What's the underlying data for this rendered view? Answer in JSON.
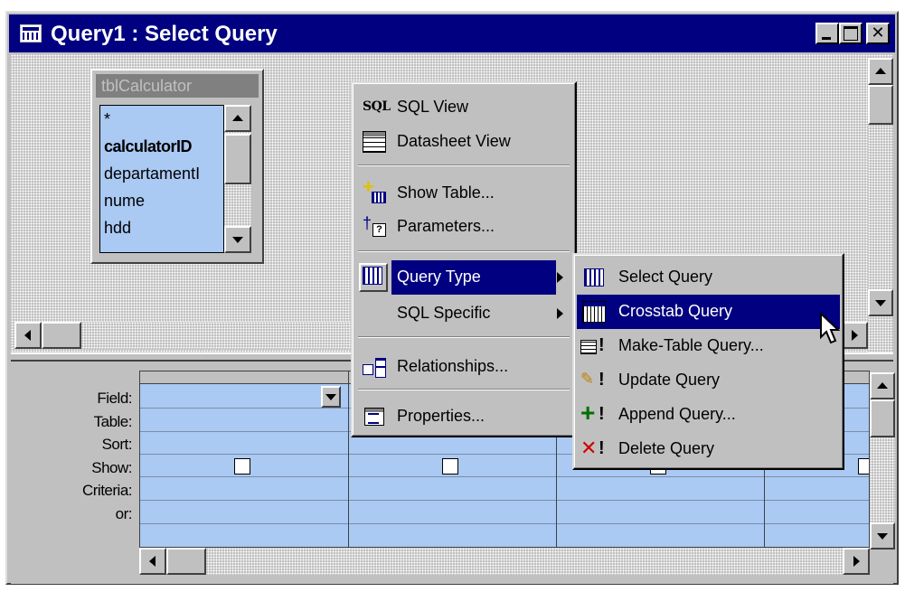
{
  "window": {
    "title": "Query1 : Select Query",
    "close_glyph": "✕"
  },
  "field_list": {
    "title": "tblCalculator",
    "items": [
      "*",
      "calculatorID",
      "departamentI",
      "nume",
      "hdd"
    ]
  },
  "grid": {
    "row_labels": [
      "Field:",
      "Table:",
      "Sort:",
      "Show:",
      "Criteria:",
      "or:"
    ]
  },
  "context_menu": {
    "sql_glyph": "SQL",
    "sql_view": "SQL View",
    "datasheet_view": "Datasheet View",
    "show_table": "Show Table...",
    "parameters": "Parameters...",
    "query_type": "Query Type",
    "sql_specific": "SQL Specific",
    "relationships": "Relationships...",
    "properties": "Properties..."
  },
  "submenu": {
    "select_query": "Select Query",
    "crosstab_query": "Crosstab Query",
    "make_table_query": "Make-Table Query...",
    "update_query": "Update Query",
    "append_query": "Append Query...",
    "delete_query": "Delete Query",
    "bang": "!"
  },
  "colors": {
    "title_bar": "#000080",
    "grid_fill": "#aac9f3",
    "highlight": "#000080"
  }
}
